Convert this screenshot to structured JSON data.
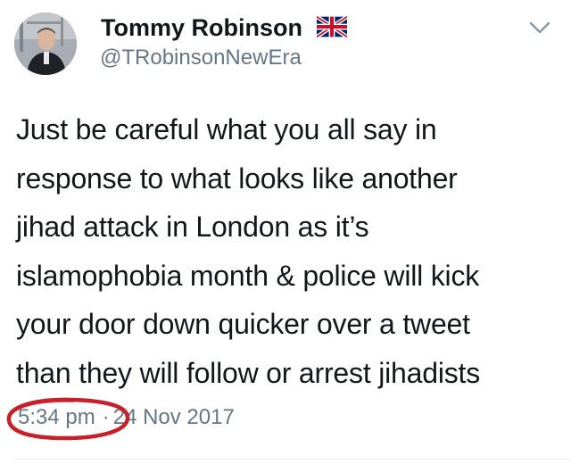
{
  "author": {
    "display_name": "Tommy Robinson",
    "handle": "@TRobinsonNewEra",
    "flag_icon": "uk-flag-icon",
    "avatar_icon": "profile-photo"
  },
  "tweet": {
    "lines": [
      "Just be careful what you all say in",
      "response to what looks like another",
      "jihad attack in London as it’s",
      "islamophobia month & police will kick",
      "your door down quicker over a tweet",
      "than they will follow or arrest jihadists"
    ],
    "time": "5:34 pm",
    "separator": "·",
    "date": "24 Nov 2017"
  },
  "menu": {
    "icon": "chevron-down-icon"
  },
  "colors": {
    "text": "#14171a",
    "secondary": "#657786",
    "annotation_circle": "#c8202a",
    "divider": "#e6ecf0"
  }
}
